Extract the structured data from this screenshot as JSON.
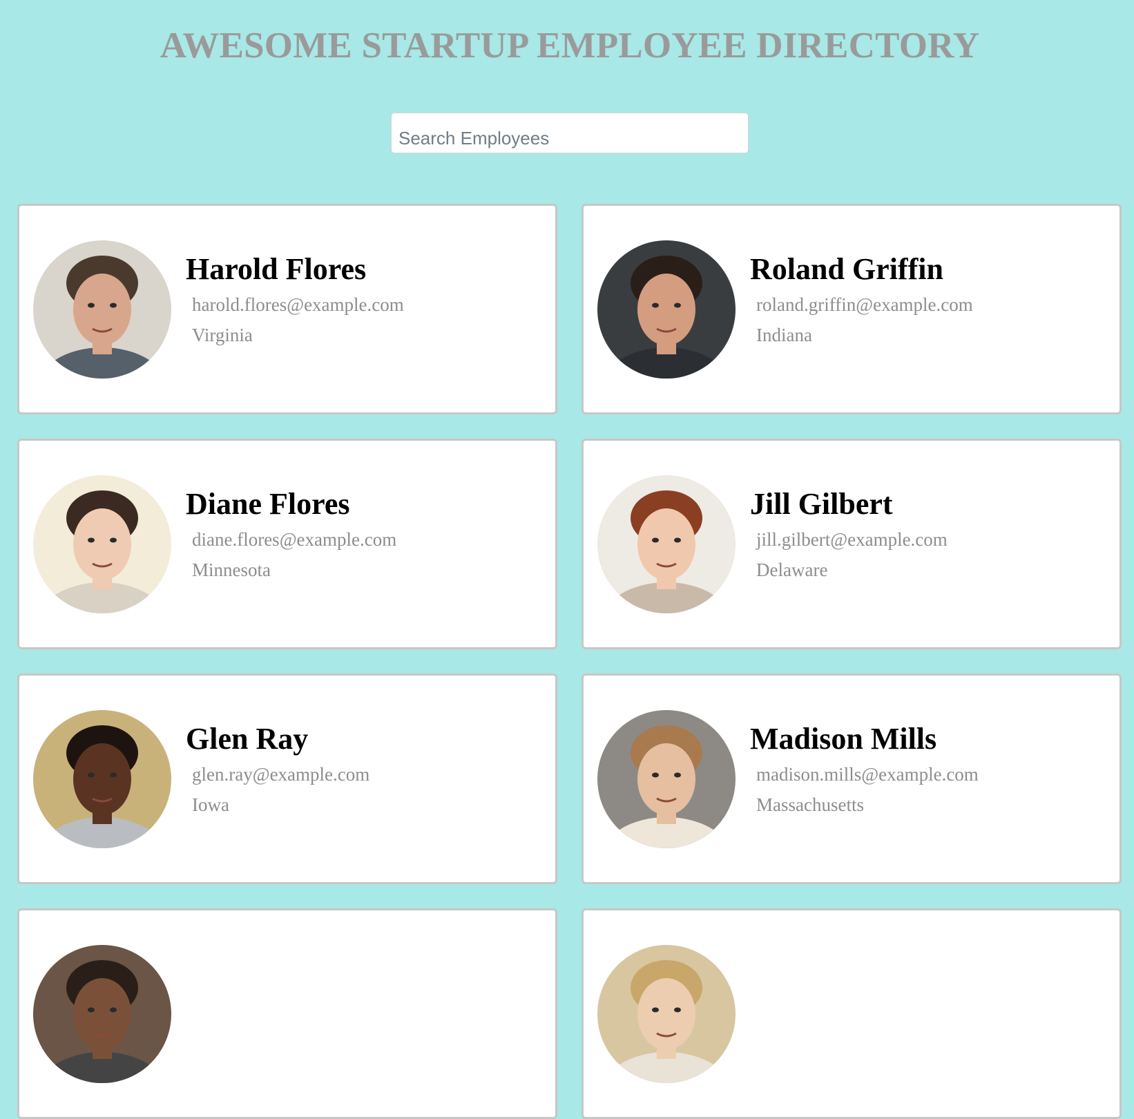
{
  "header": {
    "title": "AWESOME STARTUP EMPLOYEE DIRECTORY"
  },
  "search": {
    "placeholder": "Search Employees"
  },
  "employees": [
    {
      "name": "Harold Flores",
      "email": "harold.flores@example.com",
      "location": "Virginia",
      "photo_bg": "#d9d4cc",
      "photo_skin": "#d8a68c",
      "photo_hair": "#4a3a2e",
      "photo_shirt": "#55606a"
    },
    {
      "name": "Roland Griffin",
      "email": "roland.griffin@example.com",
      "location": "Indiana",
      "photo_bg": "#3a3d40",
      "photo_skin": "#d49d80",
      "photo_hair": "#2a1e18",
      "photo_shirt": "#2b2f34"
    },
    {
      "name": "Diane Flores",
      "email": "diane.flores@example.com",
      "location": "Minnesota",
      "photo_bg": "#f3ecd8",
      "photo_skin": "#eecbb2",
      "photo_hair": "#3b2a22",
      "photo_shirt": "#d9d1c3"
    },
    {
      "name": "Jill Gilbert",
      "email": "jill.gilbert@example.com",
      "location": "Delaware",
      "photo_bg": "#eeeae4",
      "photo_skin": "#f0c8ae",
      "photo_hair": "#8a3f22",
      "photo_shirt": "#c9b9a9"
    },
    {
      "name": "Glen Ray",
      "email": "glen.ray@example.com",
      "location": "Iowa",
      "photo_bg": "#c9b27a",
      "photo_skin": "#5a3322",
      "photo_hair": "#1e140f",
      "photo_shirt": "#b9bcc0"
    },
    {
      "name": "Madison Mills",
      "email": "madison.mills@example.com",
      "location": "Massachusetts",
      "photo_bg": "#8d8a86",
      "photo_skin": "#e6bea0",
      "photo_hair": "#a87a4e",
      "photo_shirt": "#efe6da"
    },
    {
      "name": "",
      "email": "",
      "location": "",
      "photo_bg": "#6b5546",
      "photo_skin": "#7a5138",
      "photo_hair": "#2a1e18",
      "photo_shirt": "#444444"
    },
    {
      "name": "",
      "email": "",
      "location": "",
      "photo_bg": "#d8c6a0",
      "photo_skin": "#eccdb0",
      "photo_hair": "#c9a66a",
      "photo_shirt": "#e9e2d6"
    }
  ]
}
